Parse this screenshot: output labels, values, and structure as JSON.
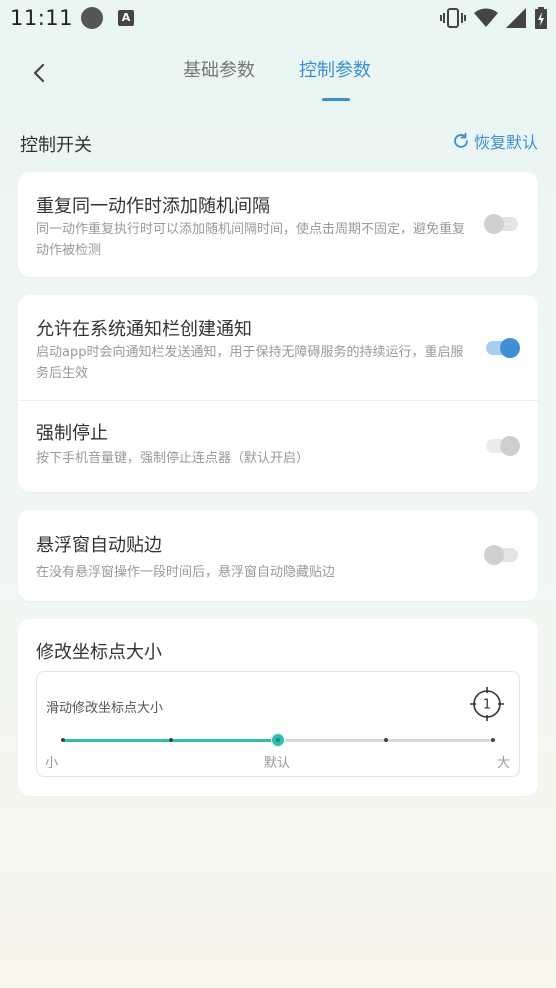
{
  "status_bar": {
    "time": "11:11",
    "a_badge": "A"
  },
  "nav": {
    "back_icon": "chevron-left-icon",
    "tabs": [
      {
        "label": "基础参数"
      },
      {
        "label": "控制参数"
      }
    ],
    "active_tab": 1
  },
  "section": {
    "title": "控制开关",
    "reset_label": "恢复默认",
    "reset_icon": "refresh-icon"
  },
  "settings": {
    "random_interval": {
      "title": "重复同一动作时添加随机间隔",
      "desc": "同一动作重复执行时可以添加随机间隔时间，使点击周期不固定，避免重复动作被检测",
      "state": "off"
    },
    "notification": {
      "title": "允许在系统通知栏创建通知",
      "desc": "启动app时会向通知栏发送通知，用于保持无障碍服务的持续运行，重启服务后生效",
      "state": "on"
    },
    "force_stop": {
      "title": "强制停止",
      "desc": "按下手机音量键，强制停止连点器（默认开启）",
      "state": "disabled-on"
    },
    "float_edge": {
      "title": "悬浮窗自动贴边",
      "desc": "在没有悬浮窗操作一段时间后，悬浮窗自动隐藏贴边",
      "state": "off"
    }
  },
  "coordinate_size": {
    "title": "修改坐标点大小",
    "label": "滑动修改坐标点大小",
    "indicator_number": "1",
    "slider": {
      "steps": 5,
      "value_index": 2,
      "min_label": "小",
      "mid_label": "默认",
      "max_label": "大"
    }
  },
  "colors": {
    "accent": "#3d8fcf",
    "slider": "#2bbfae",
    "switch_on": "#3f8fd6"
  }
}
